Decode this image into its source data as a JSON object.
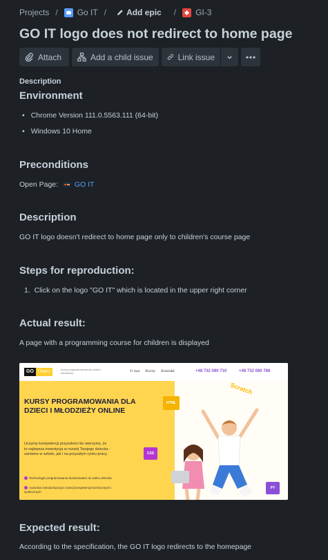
{
  "breadcrumbs": {
    "projects": "Projects",
    "project": "Go IT",
    "add_epic": "Add epic",
    "issue_key": "GI-3"
  },
  "issue": {
    "title": "GO IT logo does not redirect to home page"
  },
  "toolbar": {
    "attach": "Attach",
    "add_child": "Add a child issue",
    "link_issue": "Link issue"
  },
  "description_label": "Description",
  "environment": {
    "heading": "Environment",
    "items": [
      "Chrome Version 111.0.5563.111 (64-bit)",
      "Windows 10 Home"
    ]
  },
  "preconditions": {
    "heading": "Preconditions",
    "prefix": "Open Page:",
    "link_text": "GO IT"
  },
  "description": {
    "heading": "Description",
    "text": "GO IT logo doesn't redirect to home page only to children's course page"
  },
  "steps": {
    "heading": "Steps for reproduction:",
    "items": [
      "Click on the logo \"GO IT\" which is located in the upper right corner"
    ]
  },
  "actual": {
    "heading": "Actual result:",
    "text": "A page with a programming course for children is displayed"
  },
  "embedded_screenshot": {
    "logo_go": "GO",
    "logo_kids": "ITeens",
    "tagline": "Kursy programowania dla dzieci i młodzieży",
    "menu": [
      "O nas",
      "Kursy",
      "Kontakt"
    ],
    "phones": [
      "+48 732 080 710",
      "+48 732 080 788"
    ],
    "headline": "KURSY PROGRAMOWANIA DLA DZIECI I MŁODZIEŻY ONLINE",
    "body": "Uczymy kompetencji przyszłości bo wierzymy, że to najlepsza inwestycja w rozwój Twojego dziecka - zarówno w szkole, jak i na przyszłym rynku pracy.",
    "features": [
      "Technologie programowania dostosowane do wieku dziecka",
      "Autorska metoda łącząca rozwój kompetencji technicznych i społecznych"
    ],
    "stickers": [
      "HTML",
      "CSS",
      "PY"
    ],
    "scratch": "Scratch"
  },
  "expected": {
    "heading": "Expected result:",
    "text": "According to the specification, the GO IT logo redirects to the homepage"
  }
}
